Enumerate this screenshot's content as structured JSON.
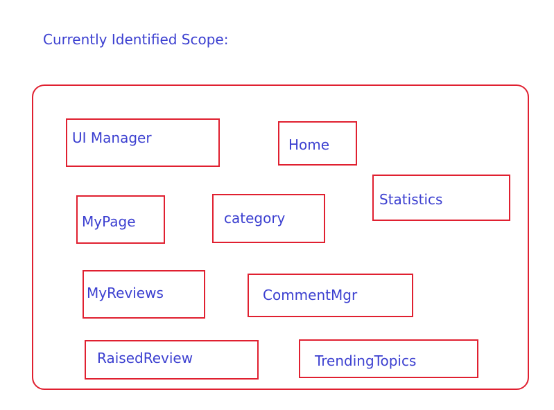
{
  "heading": "Currently Identified Scope:",
  "colors": {
    "border": "#e02030",
    "text": "#3b3fd0",
    "background": "#ffffff"
  },
  "modules": [
    {
      "label": "UI Manager"
    },
    {
      "label": "Home"
    },
    {
      "label": "Statistics"
    },
    {
      "label": "MyPage"
    },
    {
      "label": "category"
    },
    {
      "label": "MyReviews"
    },
    {
      "label": "CommentMgr"
    },
    {
      "label": "RaisedReview"
    },
    {
      "label": "TrendingTopics"
    }
  ]
}
